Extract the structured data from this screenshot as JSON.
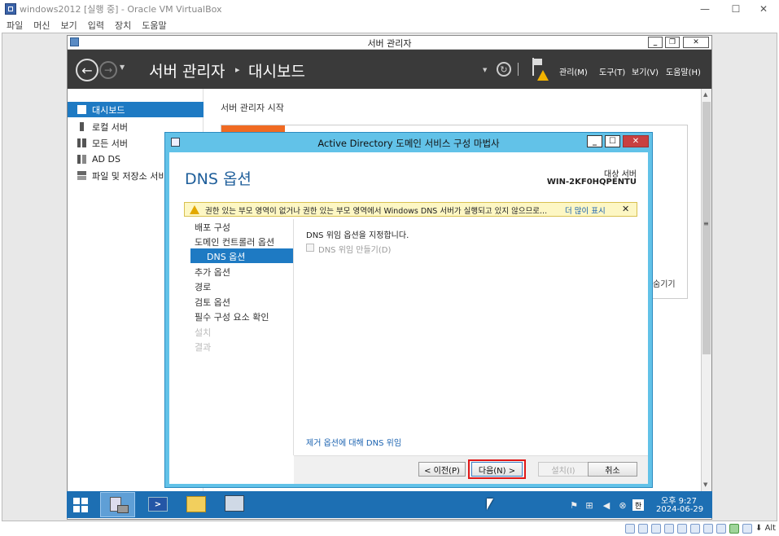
{
  "vbox": {
    "title": "windows2012 [실행 중] - Oracle VM VirtualBox",
    "menu": [
      "파일",
      "머신",
      "보기",
      "입력",
      "장치",
      "도움말"
    ],
    "status_key": "Alt"
  },
  "server_manager": {
    "window_title": "서버 관리자",
    "breadcrumb_root": "서버 관리자",
    "breadcrumb_sep": "▸",
    "breadcrumb_current": "대시보드",
    "menu": [
      "관리(M)",
      "도구(T)",
      "보기(V)",
      "도움말(H)"
    ],
    "nav": [
      {
        "label": "대시보드",
        "icon": "dashboard-icon"
      },
      {
        "label": "로컬 서버",
        "icon": "local-server-icon"
      },
      {
        "label": "모든 서버",
        "icon": "all-servers-icon"
      },
      {
        "label": "AD DS",
        "icon": "ad-ds-icon"
      },
      {
        "label": "파일 및 저장소 서비",
        "icon": "file-storage-icon"
      }
    ],
    "welcome_heading": "서버 관리자 시작",
    "hide_link": "숨기기"
  },
  "wizard": {
    "title": "Active Directory 도메인 서비스 구성 마법사",
    "page_heading": "DNS 옵션",
    "target_label": "대상 서버",
    "target_server": "WIN-2KF0HQPENTU",
    "warning_text": "권한 있는 부모 영역이 없거나 권한 있는 부모 영역에서 Windows DNS 서버가 실행되고 있지 않으므로...",
    "warning_more": "더 많이 표시",
    "steps": [
      {
        "label": "배포 구성",
        "state": "done"
      },
      {
        "label": "도메인 컨트롤러 옵션",
        "state": "done"
      },
      {
        "label": "DNS 옵션",
        "state": "current"
      },
      {
        "label": "추가 옵션",
        "state": "pending"
      },
      {
        "label": "경로",
        "state": "pending"
      },
      {
        "label": "검토 옵션",
        "state": "pending"
      },
      {
        "label": "필수 구성 요소 확인",
        "state": "pending"
      },
      {
        "label": "설치",
        "state": "disabled"
      },
      {
        "label": "결과",
        "state": "disabled"
      }
    ],
    "instruction": "DNS 위임 옵션을 지정합니다.",
    "checkbox_label": "DNS 위임 만들기(D)",
    "checkbox_checked": false,
    "help_link": "제거 옵션에 대해 DNS 위임",
    "buttons": {
      "prev": "< 이전(P)",
      "next": "다음(N) >",
      "install": "설치(I)",
      "cancel": "취소"
    }
  },
  "taskbar": {
    "time": "오후 9:27",
    "date": "2024-06-29",
    "ime": "한"
  },
  "colors": {
    "wizard_frame": "#62c2e8",
    "accent_blue": "#1e7ac3",
    "header_dark": "#3a3a3a",
    "taskbar": "#1d6fb3",
    "warning_bg": "#fdf7c4",
    "highlight_red": "#e01818"
  }
}
